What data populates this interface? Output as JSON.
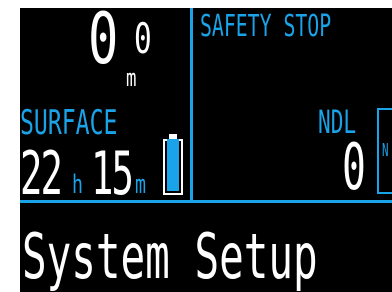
{
  "depth": {
    "integer": "0",
    "decimal": "0",
    "unit": "m"
  },
  "mode": {
    "label": "SURFACE"
  },
  "surface_time": {
    "hours": "22",
    "hours_unit": "h",
    "minutes": "15",
    "minutes_unit": "m"
  },
  "battery": {
    "level_fraction": 1.0,
    "icon": "battery-icon"
  },
  "safety_stop": {
    "label": "SAFETY STOP"
  },
  "ndl": {
    "label": "NDL",
    "value": "0",
    "bar_text": "N"
  },
  "menu": {
    "title": "System Setup"
  },
  "colors": {
    "accent": "#1aa3e8",
    "text": "#ffffff",
    "background": "#000000"
  }
}
